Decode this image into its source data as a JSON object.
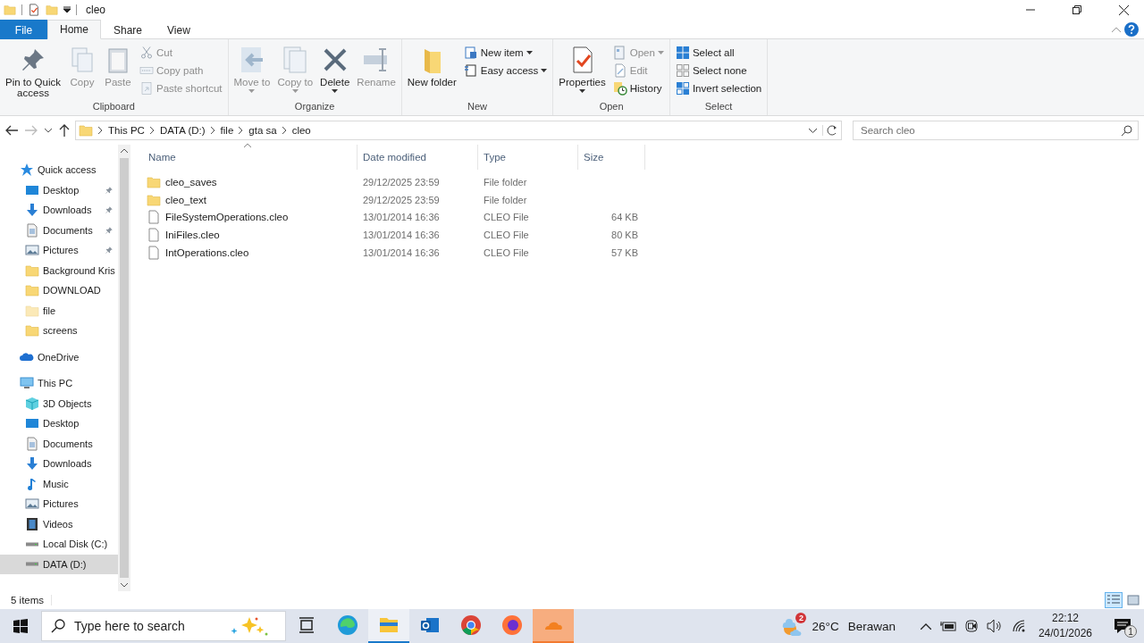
{
  "window": {
    "title": "cleo"
  },
  "tabs": [
    {
      "label": "File",
      "kind": "file",
      "selected": false
    },
    {
      "label": "Home",
      "kind": "tab",
      "selected": true
    },
    {
      "label": "Share",
      "kind": "tab",
      "selected": false
    },
    {
      "label": "View",
      "kind": "tab",
      "selected": false
    }
  ],
  "ribbon": {
    "groups": [
      {
        "label": "Clipboard",
        "items": [
          {
            "kind": "large",
            "label": "Pin to Quick access",
            "disabled": false,
            "menu": false
          },
          {
            "kind": "large",
            "label": "Copy",
            "disabled": true,
            "menu": false
          },
          {
            "kind": "large",
            "label": "Paste",
            "disabled": true,
            "menu": false
          },
          {
            "kind": "small",
            "label": "Cut",
            "disabled": true,
            "menu": false
          },
          {
            "kind": "small",
            "label": "Copy path",
            "disabled": true,
            "menu": false
          },
          {
            "kind": "small",
            "label": "Paste shortcut",
            "disabled": true,
            "menu": false
          }
        ]
      },
      {
        "label": "Organize",
        "items": [
          {
            "kind": "large",
            "label": "Move to",
            "disabled": true,
            "menu": true
          },
          {
            "kind": "large",
            "label": "Copy to",
            "disabled": true,
            "menu": true
          },
          {
            "kind": "large",
            "label": "Delete",
            "disabled": false,
            "menu": true
          },
          {
            "kind": "large",
            "label": "Rename",
            "disabled": true,
            "menu": false
          }
        ]
      },
      {
        "label": "New",
        "items": [
          {
            "kind": "large",
            "label": "New folder",
            "disabled": false,
            "menu": false
          },
          {
            "kind": "small",
            "label": "New item",
            "disabled": false,
            "menu": true
          },
          {
            "kind": "small",
            "label": "Easy access",
            "disabled": false,
            "menu": true
          }
        ]
      },
      {
        "label": "Open",
        "items": [
          {
            "kind": "large",
            "label": "Properties",
            "disabled": false,
            "menu": true
          },
          {
            "kind": "small",
            "label": "Open",
            "disabled": true,
            "menu": true
          },
          {
            "kind": "small",
            "label": "Edit",
            "disabled": true,
            "menu": false
          },
          {
            "kind": "small",
            "label": "History",
            "disabled": false,
            "menu": false
          }
        ]
      },
      {
        "label": "Select",
        "items": [
          {
            "kind": "small",
            "label": "Select all",
            "disabled": false,
            "menu": false
          },
          {
            "kind": "small",
            "label": "Select none",
            "disabled": false,
            "menu": false
          },
          {
            "kind": "small",
            "label": "Invert selection",
            "disabled": false,
            "menu": false
          }
        ]
      }
    ]
  },
  "address": {
    "crumbs": [
      "This PC",
      "DATA (D:)",
      "file",
      "gta sa",
      "cleo"
    ]
  },
  "search": {
    "placeholder": "Search cleo"
  },
  "nav_pane": {
    "items": [
      {
        "label": "Quick access",
        "kind": "star",
        "selected": false,
        "children": [
          {
            "label": "Desktop",
            "kind": "desktop",
            "pinned": true,
            "selected": false
          },
          {
            "label": "Downloads",
            "kind": "downloads",
            "pinned": true,
            "selected": false
          },
          {
            "label": "Documents",
            "kind": "documents",
            "pinned": true,
            "selected": false
          },
          {
            "label": "Pictures",
            "kind": "pictures",
            "pinned": true,
            "selected": false
          },
          {
            "label": "Background Kris",
            "kind": "folder",
            "pinned": false,
            "selected": false
          },
          {
            "label": "DOWNLOAD",
            "kind": "folder",
            "pinned": false,
            "selected": false
          },
          {
            "label": "file",
            "kind": "folder_light",
            "pinned": false,
            "selected": false
          },
          {
            "label": "screens",
            "kind": "folder",
            "pinned": false,
            "selected": false
          }
        ]
      },
      {
        "label": "OneDrive",
        "kind": "cloud",
        "selected": false
      },
      {
        "label": "This PC",
        "kind": "pc",
        "selected": false,
        "children": [
          {
            "label": "3D Objects",
            "kind": "objects",
            "pinned": false,
            "selected": false
          },
          {
            "label": "Desktop",
            "kind": "desktop",
            "pinned": false,
            "selected": false
          },
          {
            "label": "Documents",
            "kind": "documents",
            "pinned": false,
            "selected": false
          },
          {
            "label": "Downloads",
            "kind": "downloads",
            "pinned": false,
            "selected": false
          },
          {
            "label": "Music",
            "kind": "music",
            "pinned": false,
            "selected": false
          },
          {
            "label": "Pictures",
            "kind": "pictures",
            "pinned": false,
            "selected": false
          },
          {
            "label": "Videos",
            "kind": "videos",
            "pinned": false,
            "selected": false
          },
          {
            "label": "Local Disk (C:)",
            "kind": "disk",
            "pinned": false,
            "selected": false
          },
          {
            "label": "DATA (D:)",
            "kind": "disk",
            "pinned": false,
            "selected": true
          }
        ]
      }
    ]
  },
  "table": {
    "columns": [
      "Name",
      "Date modified",
      "Type",
      "Size"
    ],
    "rows": [
      {
        "kind": "folder",
        "name": "cleo_saves",
        "date": "29/12/2025 23:59",
        "type": "File folder",
        "selected": false
      },
      {
        "kind": "folder",
        "name": "cleo_text",
        "date": "29/12/2025 23:59",
        "type": "File folder",
        "selected": false
      },
      {
        "kind": "file",
        "name": "FileSystemOperations.cleo",
        "date": "13/01/2014 16:36",
        "type": "CLEO File",
        "size": "64 KB",
        "selected": false
      },
      {
        "kind": "file",
        "name": "IniFiles.cleo",
        "date": "13/01/2014 16:36",
        "type": "CLEO File",
        "size": "80 KB",
        "selected": false
      },
      {
        "kind": "file",
        "name": "IntOperations.cleo",
        "date": "13/01/2014 16:36",
        "type": "CLEO File",
        "size": "57 KB",
        "selected": false
      }
    ]
  },
  "status_bar": {
    "text": "5 items",
    "views": [
      {
        "kind": "details",
        "selected": true
      },
      {
        "kind": "large",
        "selected": false
      }
    ]
  },
  "taskbar": {
    "search_placeholder": "Type here to search",
    "apps": [
      {
        "kind": "edge",
        "active": false,
        "flashing": false
      },
      {
        "kind": "explorer",
        "active": true,
        "flashing": false
      },
      {
        "kind": "outlook",
        "active": false,
        "flashing": false
      },
      {
        "kind": "chrome",
        "active": false,
        "flashing": false
      },
      {
        "kind": "firefox",
        "active": false,
        "flashing": false
      },
      {
        "kind": "cloud",
        "active": true,
        "flashing": true
      }
    ],
    "weather": {
      "badge": "2",
      "temperature": "26°C",
      "condition": "Berawan"
    },
    "clock": {
      "time": "22:12",
      "date": "24/01/2026"
    },
    "notifications": {
      "badge": "1"
    }
  }
}
